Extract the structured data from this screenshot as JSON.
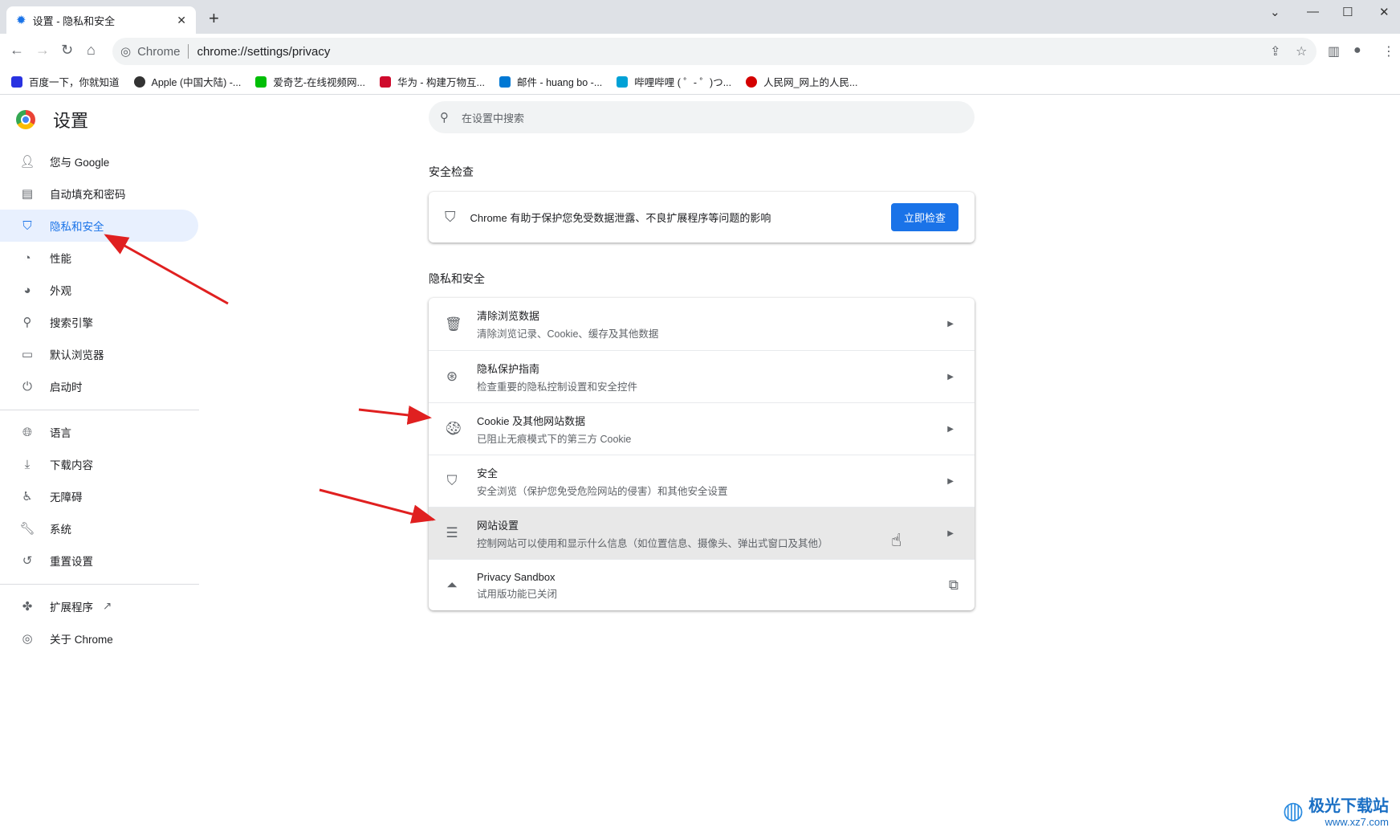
{
  "browser": {
    "tab_title": "设置 - 隐私和安全",
    "omnibox_label": "Chrome",
    "url": "chrome://settings/privacy",
    "bookmarks": [
      {
        "label": "百度一下，你就知道",
        "color": "#2932e1"
      },
      {
        "label": "Apple (中国大陆) -...",
        "color": "#333333"
      },
      {
        "label": "爱奇艺-在线视频网...",
        "color": "#00be06"
      },
      {
        "label": "华为 - 构建万物互...",
        "color": "#cf0a2c"
      },
      {
        "label": "邮件 - huang bo -...",
        "color": "#0078d4"
      },
      {
        "label": "哔哩哔哩 ( ゜- ゜)つ...",
        "color": "#00a1d6"
      },
      {
        "label": "人民网_网上的人民...",
        "color": "#d40000"
      }
    ]
  },
  "sidebar": {
    "title": "设置",
    "items": [
      {
        "label": "您与 Google",
        "icon": "person-icon"
      },
      {
        "label": "自动填充和密码",
        "icon": "clipboard-icon"
      },
      {
        "label": "隐私和安全",
        "icon": "shield-icon",
        "active": true
      },
      {
        "label": "性能",
        "icon": "speedometer-icon"
      },
      {
        "label": "外观",
        "icon": "palette-icon"
      },
      {
        "label": "搜索引擎",
        "icon": "search-icon"
      },
      {
        "label": "默认浏览器",
        "icon": "browser-icon"
      },
      {
        "label": "启动时",
        "icon": "power-icon"
      },
      {
        "label": "语言",
        "icon": "globe-icon"
      },
      {
        "label": "下载内容",
        "icon": "download-icon"
      },
      {
        "label": "无障碍",
        "icon": "accessibility-icon"
      },
      {
        "label": "系统",
        "icon": "wrench-icon"
      },
      {
        "label": "重置设置",
        "icon": "history-icon"
      },
      {
        "label": "扩展程序",
        "icon": "puzzle-icon"
      },
      {
        "label": "关于 Chrome",
        "icon": "chrome-icon"
      }
    ]
  },
  "search": {
    "placeholder": "在设置中搜索"
  },
  "safety_check": {
    "heading": "安全检查",
    "text": "Chrome 有助于保护您免受数据泄露、不良扩展程序等问题的影响",
    "button": "立即检查",
    "accent": "#1a73e8"
  },
  "privacy": {
    "heading": "隐私和安全",
    "rows": [
      {
        "title": "清除浏览数据",
        "subtitle": "清除浏览记录、Cookie、缓存及其他数据",
        "icon": "trash-icon"
      },
      {
        "title": "隐私保护指南",
        "subtitle": "检查重要的隐私控制设置和安全控件",
        "icon": "compass-icon"
      },
      {
        "title": "Cookie 及其他网站数据",
        "subtitle": "已阻止无痕模式下的第三方 Cookie",
        "icon": "cookie-icon"
      },
      {
        "title": "安全",
        "subtitle": "安全浏览（保护您免受危险网站的侵害）和其他安全设置",
        "icon": "shield-icon"
      },
      {
        "title": "网站设置",
        "subtitle": "控制网站可以使用和显示什么信息（如位置信息、摄像头、弹出式窗口及其他）",
        "icon": "sliders-icon",
        "hovered": true
      },
      {
        "title": "Privacy Sandbox",
        "subtitle": "试用版功能已关闭",
        "icon": "flask-icon"
      }
    ]
  },
  "watermark": {
    "name": "极光下载站",
    "url": "www.xz7.com"
  }
}
